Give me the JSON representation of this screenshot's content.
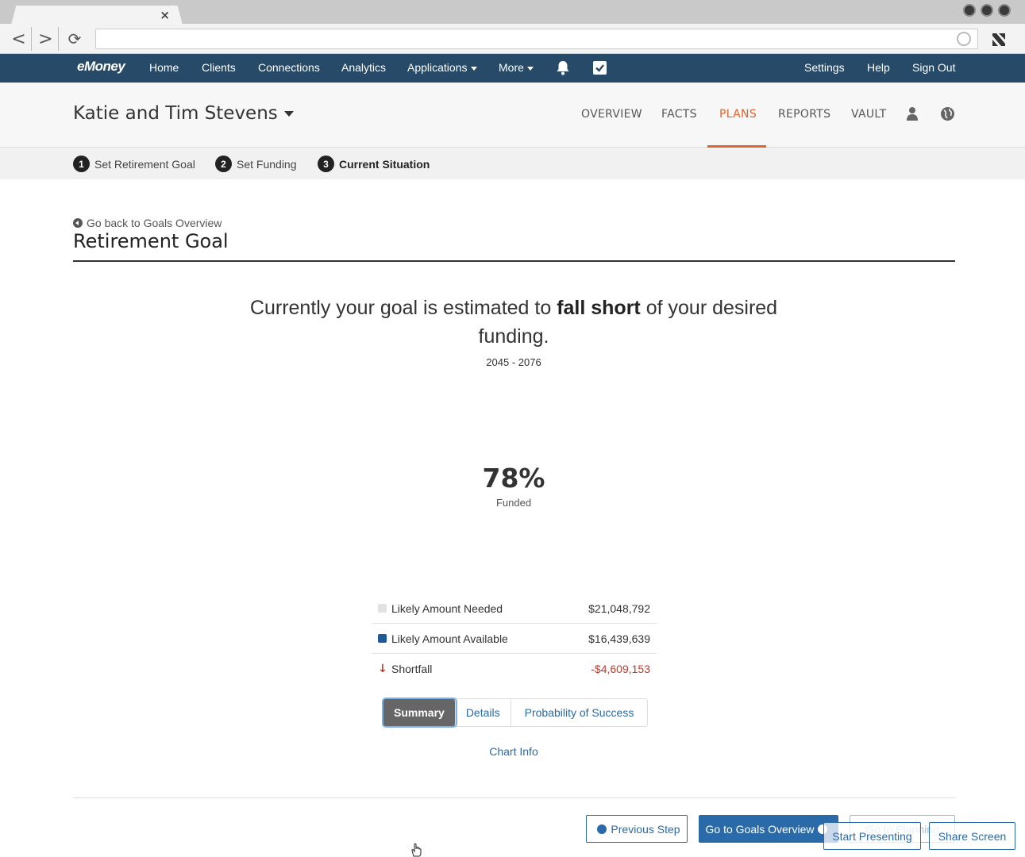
{
  "browser": {
    "tab_close_glyph": "×",
    "back_glyph": "<",
    "forward_glyph": ">",
    "reload_glyph": "⟳",
    "url": ""
  },
  "nav": {
    "brand": "eMoney",
    "items": [
      {
        "label": "Home"
      },
      {
        "label": "Clients"
      },
      {
        "label": "Connections"
      },
      {
        "label": "Analytics"
      },
      {
        "label": "Applications"
      },
      {
        "label": "More"
      }
    ],
    "right": [
      {
        "label": "Settings"
      },
      {
        "label": "Help"
      },
      {
        "label": "Sign Out"
      }
    ]
  },
  "client": {
    "name": "Katie and Tim Stevens",
    "tabs": [
      {
        "label": "OVERVIEW"
      },
      {
        "label": "FACTS"
      },
      {
        "label": "PLANS"
      },
      {
        "label": "REPORTS"
      },
      {
        "label": "VAULT"
      }
    ],
    "active_tab": "PLANS"
  },
  "steps": [
    {
      "num": "1",
      "label": "Set Retirement Goal"
    },
    {
      "num": "2",
      "label": "Set Funding"
    },
    {
      "num": "3",
      "label": "Current Situation"
    }
  ],
  "page": {
    "back_link": "Go back to Goals Overview",
    "title": "Retirement Goal",
    "headline_pre": "Currently your goal is estimated to ",
    "headline_bold": "fall short",
    "headline_post": " of your desired funding.",
    "date_range": "2045 - 2076",
    "percent": "78%",
    "percent_label": "Funded",
    "funded_fraction": 0.78
  },
  "legend": [
    {
      "label": "Likely Amount Needed",
      "value": "$21,048,792",
      "color": "#e2e2e2"
    },
    {
      "label": "Likely Amount Available",
      "value": "$16,439,639",
      "color": "#1f5a96"
    },
    {
      "label": "Shortfall",
      "value": "-$4,609,153",
      "color": "#c0392b"
    }
  ],
  "segmented": {
    "items": [
      {
        "label": "Summary"
      },
      {
        "label": "Details"
      },
      {
        "label": "Probability of Success"
      }
    ],
    "active": "Summary"
  },
  "chart_info": "Chart Info",
  "footer": {
    "previous": "Previous Step",
    "goals_overview": "Go to Goals Overview",
    "go_planning": "Go to Planning",
    "start_presenting": "Start Presenting",
    "share_screen": "Share Screen"
  },
  "colors": {
    "navbar": "#274a68",
    "accent": "#e2642b",
    "link": "#2a6aa8",
    "negative": "#c0392b"
  }
}
